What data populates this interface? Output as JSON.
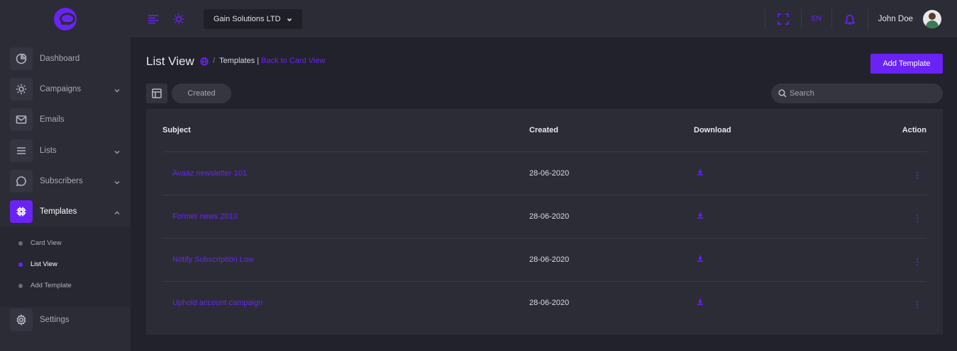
{
  "sidebar": {
    "items": [
      {
        "label": "Dashboard",
        "icon": "pie-chart-icon"
      },
      {
        "label": "Campaigns",
        "icon": "sun-icon"
      },
      {
        "label": "Emails",
        "icon": "mail-icon"
      },
      {
        "label": "Lists",
        "icon": "list-icon"
      },
      {
        "label": "Subscribers",
        "icon": "chat-bubble-icon"
      },
      {
        "label": "Templates",
        "icon": "cpu-icon"
      }
    ],
    "submenu": [
      "Card View",
      "List View",
      "Add Template"
    ],
    "settings_label": "Settings"
  },
  "topbar": {
    "company": "Gain Solutions LTD",
    "lang": "EN",
    "username": "John Doe"
  },
  "page": {
    "title": "List View",
    "breadcrumb_current": "Templates |",
    "breadcrumb_back": "Back to Card View",
    "add_button": "Add Template",
    "filter_chip": "Created",
    "search_placeholder": "Search"
  },
  "table": {
    "headers": {
      "subject": "Subject",
      "created": "Created",
      "download": "Download",
      "action": "Action"
    },
    "rows": [
      {
        "subject": "Avaaz newsletter 101",
        "created": "28-06-2020"
      },
      {
        "subject": "Former news 2010",
        "created": "28-06-2020"
      },
      {
        "subject": "Notify Subscription Low",
        "created": "28-06-2020"
      },
      {
        "subject": "Uphold account campaign",
        "created": "28-06-2020"
      }
    ]
  },
  "colors": {
    "accent": "#6a23f5",
    "background": "#22222c",
    "panel": "#2c2c37"
  }
}
